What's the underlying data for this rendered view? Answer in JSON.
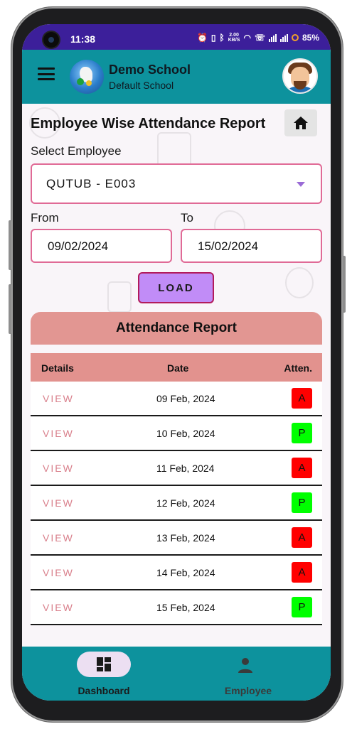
{
  "status_bar": {
    "time": "11:38",
    "network_speed_top": "2.00",
    "network_speed_bottom": "KB/S",
    "battery": "85%"
  },
  "header": {
    "school_name": "Demo School",
    "school_subtitle": "Default School"
  },
  "page": {
    "title": "Employee Wise Attendance Report"
  },
  "form": {
    "employee_label": "Select Employee",
    "employee_value": "QUTUB - E003",
    "from_label": "From",
    "from_value": "09/02/2024",
    "to_label": "To",
    "to_value": "15/02/2024",
    "load_label": "LOAD"
  },
  "report": {
    "title": "Attendance Report",
    "columns": [
      "Details",
      "Date",
      "Atten."
    ],
    "rows": [
      {
        "action": "VIEW",
        "date": "09 Feb, 2024",
        "status": "A"
      },
      {
        "action": "VIEW",
        "date": "10 Feb, 2024",
        "status": "P"
      },
      {
        "action": "VIEW",
        "date": "11 Feb, 2024",
        "status": "A"
      },
      {
        "action": "VIEW",
        "date": "12 Feb, 2024",
        "status": "P"
      },
      {
        "action": "VIEW",
        "date": "13 Feb, 2024",
        "status": "A"
      },
      {
        "action": "VIEW",
        "date": "14 Feb, 2024",
        "status": "A"
      },
      {
        "action": "VIEW",
        "date": "15 Feb, 2024",
        "status": "P"
      }
    ],
    "status_colors": {
      "A": "#ff0000",
      "P": "#00ff00"
    }
  },
  "bottom_nav": {
    "items": [
      {
        "label": "Dashboard",
        "icon": "dashboard-icon",
        "active": true
      },
      {
        "label": "Employee",
        "icon": "person-icon",
        "active": false
      }
    ]
  },
  "colors": {
    "status_bar": "#3c1f9a",
    "app_bar": "#0d929d",
    "accent_border": "#e06a96",
    "load_button": "#c18cf7",
    "report_header": "#e29692",
    "view_link": "#d9808c"
  }
}
